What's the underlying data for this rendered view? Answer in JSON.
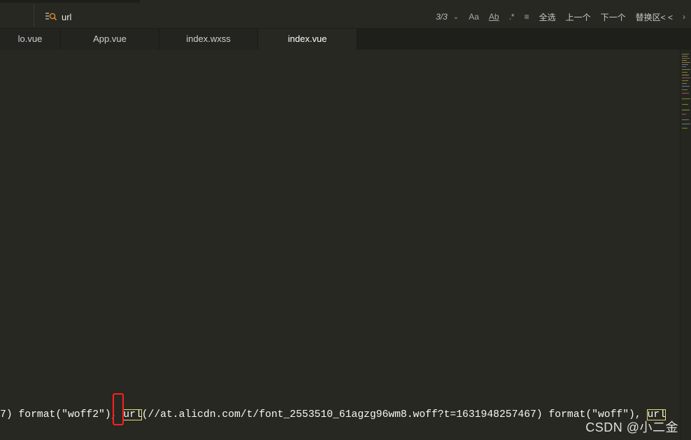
{
  "search": {
    "value": "url",
    "match_count": "3/3",
    "options": {
      "case": "Aa",
      "whole_word": "Ab",
      "regex": ".*"
    },
    "select_all": "全选",
    "prev": "上一个",
    "next": "下一个",
    "replace_toggle": "替换区< <"
  },
  "tabs": [
    {
      "label": "lo.vue",
      "active": false
    },
    {
      "label": "App.vue",
      "active": false
    },
    {
      "label": "index.wxss",
      "active": false
    },
    {
      "label": "index.vue",
      "active": true
    }
  ],
  "editor": {
    "code_before": "7) format(\"woff2\"), ",
    "match1": "url",
    "code_middle": "(//at.alicdn.com/t/font_2553510_61agzg96wm8.woff?t=1631948257467) format(\"woff\"), ",
    "match2": "url"
  },
  "watermark": "CSDN @小二金",
  "colors": {
    "background": "#272822",
    "match_outline": "#e6db74",
    "annotation_box": "#ff2020"
  }
}
